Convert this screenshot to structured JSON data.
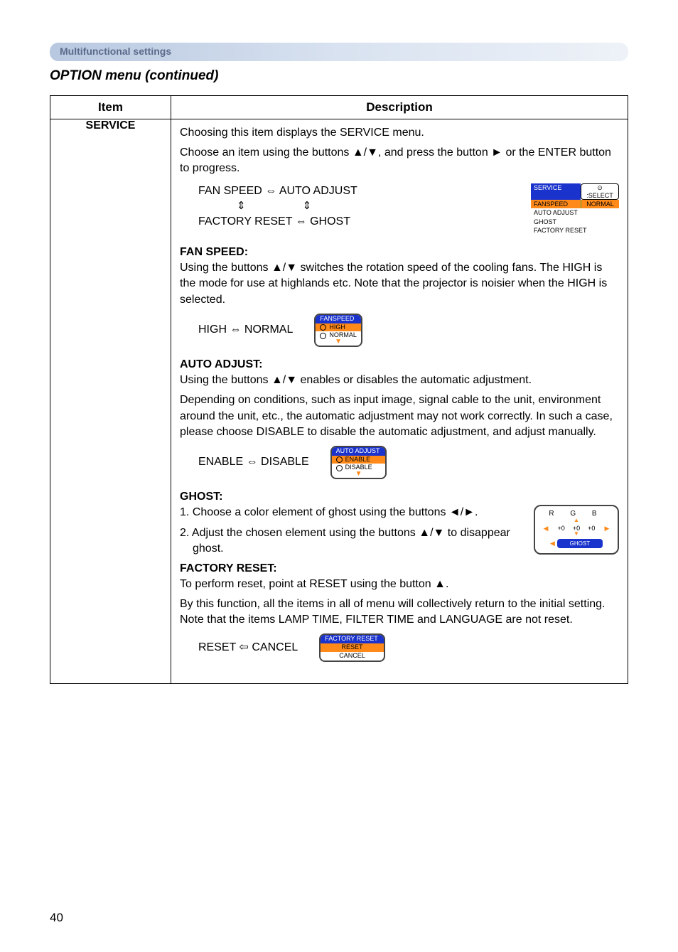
{
  "section_bar": "Multifunctional settings",
  "menu_title": "OPTION menu (continued)",
  "table": {
    "header_item": "Item",
    "header_desc": "Description",
    "item_name": "SERVICE",
    "desc": {
      "intro1": "Choosing this item displays the SERVICE menu.",
      "intro2": "Choose an item using the buttons ▲/▼, and press the button ► or the ENTER button to progress.",
      "nav_line1": "FAN SPEED ⇔ AUTO ADJUST",
      "nav_arrow_glyph": "⇕",
      "nav_line3": "FACTORY RESET ⇔ GHOST",
      "service_box": {
        "title": "SERVICE",
        "select": "⊙ :SELECT",
        "row_sel_l": "FANSPEED",
        "row_sel_r": "NORMAL",
        "r1": "AUTO ADJUST",
        "r2": "GHOST",
        "r3": "FACTORY RESET"
      },
      "fanspeed": {
        "heading": "FAN SPEED:",
        "text": "Using the buttons ▲/▼ switches the rotation speed of the cooling fans. The HIGH is the mode for use at highlands etc. Note that the projector is noisier when the HIGH is selected.",
        "toggle": "HIGH ⇔ NORMAL",
        "box_title": "FANSPEED",
        "box_opt1": "HIGH",
        "box_opt2": "NORMAL"
      },
      "autoadjust": {
        "heading": "AUTO ADJUST:",
        "text1": "Using the buttons ▲/▼ enables or disables the automatic adjustment.",
        "text2": "Depending on conditions, such as input image, signal cable to the unit, environment around the unit, etc., the automatic adjustment may not work correctly.  In such a case, please choose DISABLE to disable the automatic adjustment, and adjust manually.",
        "toggle": "ENABLE ⇔ DISABLE",
        "box_title": "AUTO ADJUST",
        "box_opt1": "ENABLE",
        "box_opt2": "DISABLE"
      },
      "ghost": {
        "heading": "GHOST:",
        "step1": "1. Choose a color element of ghost using the buttons ◄/►.",
        "step2": "2. Adjust the chosen element using the buttons ▲/▼ to disappear ghost.",
        "box_labels": "R   G   B",
        "box_v1": "+0",
        "box_v2": "+0",
        "box_v3": "+0",
        "box_btn": "GHOST"
      },
      "factoryreset": {
        "heading": "FACTORY RESET:",
        "text1": "To perform reset, point at RESET using the button ▲.",
        "text2": "By this function, all the items in all of menu will collectively return to the initial setting. Note that the items LAMP TIME, FILTER TIME and LANGUAGE are not reset.",
        "toggle": "RESET ⇦ CANCEL",
        "box_title": "FACTORY RESET",
        "box_opt1": "RESET",
        "box_opt2": "CANCEL"
      }
    }
  },
  "page_number": "40"
}
